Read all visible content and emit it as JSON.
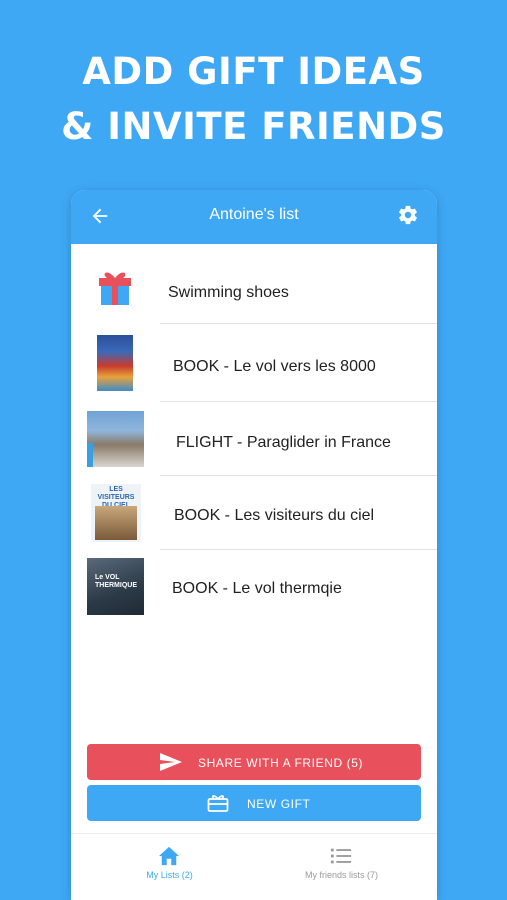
{
  "promo": {
    "line1": "ADD GIFT IDEAS",
    "line2": "& INVITE FRIENDS"
  },
  "appbar": {
    "title": "Antoine's list",
    "back_icon": "arrow-left-icon",
    "settings_icon": "gear-icon"
  },
  "items": [
    {
      "label": "Swimming shoes",
      "thumb": "gift-icon"
    },
    {
      "label": "BOOK - Le vol vers les 8000",
      "thumb": "book-cover"
    },
    {
      "label": "FLIGHT - Paraglider in France",
      "thumb": "mountain-photo"
    },
    {
      "label": "BOOK - Les visiteurs du ciel",
      "thumb": "book-cover",
      "cover_text": "LES VISITEURS DU CIEL"
    },
    {
      "label": "BOOK - Le vol thermqie",
      "thumb": "book-cover",
      "cover_text": "Le VOL THERMIQUE"
    }
  ],
  "actions": {
    "share": "SHARE WITH A FRIEND (5)",
    "new_gift": "NEW GIFT"
  },
  "tabs": [
    {
      "label": "My Lists (2)",
      "icon": "home-icon",
      "active": true
    },
    {
      "label": "My friends lists (7)",
      "icon": "list-icon",
      "active": false
    }
  ],
  "colors": {
    "primary": "#3ea8f5",
    "share": "#e8505b",
    "inactive": "#9a9a9a"
  }
}
